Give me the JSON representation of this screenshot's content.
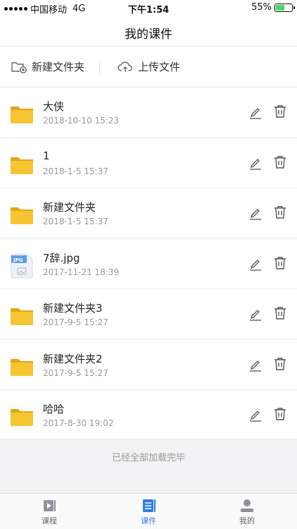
{
  "status_bar": {
    "carrier": "中国移动",
    "network": "4G",
    "time": "下午1:54",
    "battery_percent": "55%",
    "battery_level": 0.55
  },
  "nav": {
    "title": "我的课件"
  },
  "actions": {
    "new_folder": "新建文件夹",
    "upload": "上传文件"
  },
  "files": [
    {
      "name": "大侠",
      "date": "2018-10-10 15:23",
      "type": "folder-icon"
    },
    {
      "name": "1",
      "date": "2018-1-5 15:37",
      "type": "folder-icon"
    },
    {
      "name": "新建文件夹",
      "date": "2018-1-5 15:37",
      "type": "folder-icon"
    },
    {
      "name": "7辞.jpg",
      "date": "2017-11-21 18:39",
      "type": "jpg-file-icon",
      "badge": "JPG"
    },
    {
      "name": "新建文件夹3",
      "date": "2017-9-5 15:27",
      "type": "folder-icon"
    },
    {
      "name": "新建文件夹2",
      "date": "2017-9-5 15:27",
      "type": "folder-icon"
    },
    {
      "name": "哈哈",
      "date": "2017-8-30 19:02",
      "type": "folder-icon"
    }
  ],
  "footer": {
    "text": "已经全部加载完毕"
  },
  "tabs": [
    {
      "label": "课程",
      "icon": "video-icon",
      "active": false
    },
    {
      "label": "课件",
      "icon": "document-icon",
      "active": true
    },
    {
      "label": "我的",
      "icon": "user-icon",
      "active": false
    }
  ],
  "colors": {
    "accent": "#2f7de1",
    "folder": "#f7c531",
    "folder_tab": "#e3a615",
    "jpg": "#5aa0e6"
  }
}
